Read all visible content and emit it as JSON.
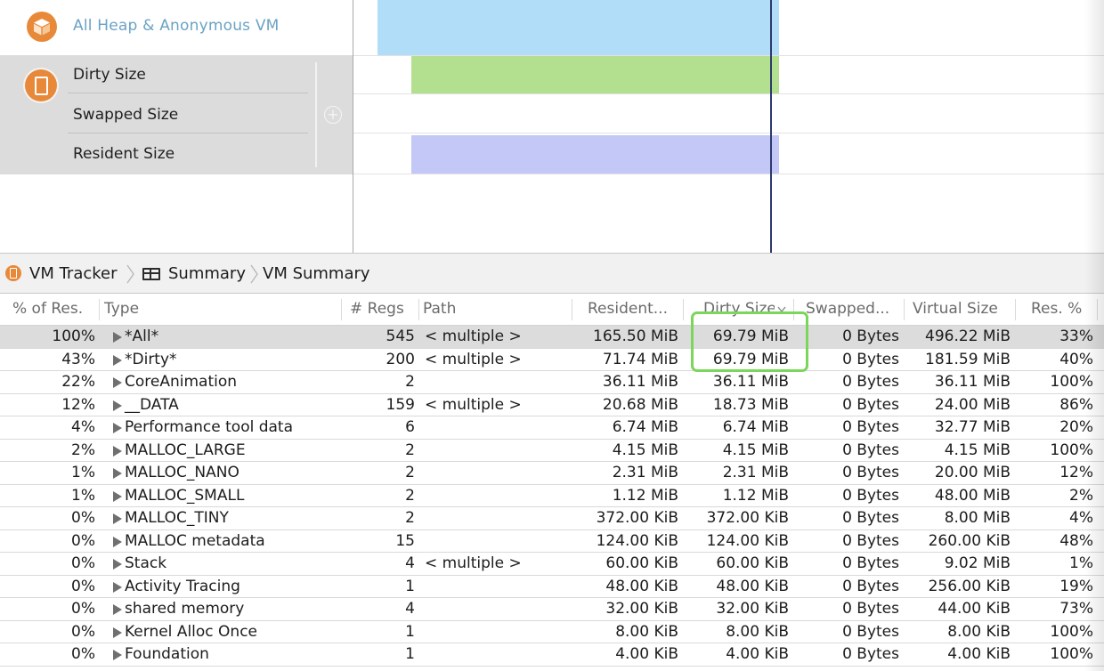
{
  "instruments": {
    "heap_label": "All Heap & Anonymous VM",
    "vm_details": [
      "Dirty Size",
      "Swapped Size",
      "Resident Size"
    ]
  },
  "jumpbar": {
    "items": [
      "VM Tracker",
      "Summary",
      "VM Summary"
    ]
  },
  "table": {
    "columns": [
      "% of Res.",
      "Type",
      "# Regs",
      "Path",
      "Resident...",
      "Dirty Size",
      "Swapped...",
      "Virtual Size",
      "Res. %"
    ],
    "sort_column": "Dirty Size",
    "rows": [
      {
        "pct": "100%",
        "type": "*All*",
        "regs": "545",
        "path": "< multiple >",
        "resident": "165.50 MiB",
        "dirty": "69.79 MiB",
        "swapped": "0 Bytes",
        "virtual": "496.22 MiB",
        "res_pct": "33%"
      },
      {
        "pct": "43%",
        "type": "*Dirty*",
        "regs": "200",
        "path": "< multiple >",
        "resident": "71.74 MiB",
        "dirty": "69.79 MiB",
        "swapped": "0 Bytes",
        "virtual": "181.59 MiB",
        "res_pct": "40%"
      },
      {
        "pct": "22%",
        "type": "CoreAnimation",
        "regs": "2",
        "path": "",
        "resident": "36.11 MiB",
        "dirty": "36.11 MiB",
        "swapped": "0 Bytes",
        "virtual": "36.11 MiB",
        "res_pct": "100%"
      },
      {
        "pct": "12%",
        "type": "__DATA",
        "regs": "159",
        "path": "< multiple >",
        "resident": "20.68 MiB",
        "dirty": "18.73 MiB",
        "swapped": "0 Bytes",
        "virtual": "24.00 MiB",
        "res_pct": "86%"
      },
      {
        "pct": "4%",
        "type": "Performance tool data",
        "regs": "6",
        "path": "",
        "resident": "6.74 MiB",
        "dirty": "6.74 MiB",
        "swapped": "0 Bytes",
        "virtual": "32.77 MiB",
        "res_pct": "20%"
      },
      {
        "pct": "2%",
        "type": "MALLOC_LARGE",
        "regs": "2",
        "path": "",
        "resident": "4.15 MiB",
        "dirty": "4.15 MiB",
        "swapped": "0 Bytes",
        "virtual": "4.15 MiB",
        "res_pct": "100%"
      },
      {
        "pct": "1%",
        "type": "MALLOC_NANO",
        "regs": "2",
        "path": "",
        "resident": "2.31 MiB",
        "dirty": "2.31 MiB",
        "swapped": "0 Bytes",
        "virtual": "20.00 MiB",
        "res_pct": "12%"
      },
      {
        "pct": "1%",
        "type": "MALLOC_SMALL",
        "regs": "2",
        "path": "",
        "resident": "1.12 MiB",
        "dirty": "1.12 MiB",
        "swapped": "0 Bytes",
        "virtual": "48.00 MiB",
        "res_pct": "2%"
      },
      {
        "pct": "0%",
        "type": "MALLOC_TINY",
        "regs": "2",
        "path": "",
        "resident": "372.00 KiB",
        "dirty": "372.00 KiB",
        "swapped": "0 Bytes",
        "virtual": "8.00 MiB",
        "res_pct": "4%"
      },
      {
        "pct": "0%",
        "type": "MALLOC metadata",
        "regs": "15",
        "path": "",
        "resident": "124.00 KiB",
        "dirty": "124.00 KiB",
        "swapped": "0 Bytes",
        "virtual": "260.00 KiB",
        "res_pct": "48%"
      },
      {
        "pct": "0%",
        "type": "Stack",
        "regs": "4",
        "path": "< multiple >",
        "resident": "60.00 KiB",
        "dirty": "60.00 KiB",
        "swapped": "0 Bytes",
        "virtual": "9.02 MiB",
        "res_pct": "1%"
      },
      {
        "pct": "0%",
        "type": "Activity Tracing",
        "regs": "1",
        "path": "",
        "resident": "48.00 KiB",
        "dirty": "48.00 KiB",
        "swapped": "0 Bytes",
        "virtual": "256.00 KiB",
        "res_pct": "19%"
      },
      {
        "pct": "0%",
        "type": "shared memory",
        "regs": "4",
        "path": "",
        "resident": "32.00 KiB",
        "dirty": "32.00 KiB",
        "swapped": "0 Bytes",
        "virtual": "44.00 KiB",
        "res_pct": "73%"
      },
      {
        "pct": "0%",
        "type": "Kernel Alloc Once",
        "regs": "1",
        "path": "",
        "resident": "8.00 KiB",
        "dirty": "8.00 KiB",
        "swapped": "0 Bytes",
        "virtual": "8.00 KiB",
        "res_pct": "100%"
      },
      {
        "pct": "0%",
        "type": "Foundation",
        "regs": "1",
        "path": "",
        "resident": "4.00 KiB",
        "dirty": "4.00 KiB",
        "swapped": "0 Bytes",
        "virtual": "4.00 KiB",
        "res_pct": "100%"
      }
    ]
  },
  "colors": {
    "heap_bar": "#b1ddf9",
    "dirty_bar": "#b3e08e",
    "resident_bar": "#c4c8f7",
    "instrument_icon": "#e8893a",
    "highlight": "#7bd65b",
    "playhead": "#2b3a6b"
  }
}
